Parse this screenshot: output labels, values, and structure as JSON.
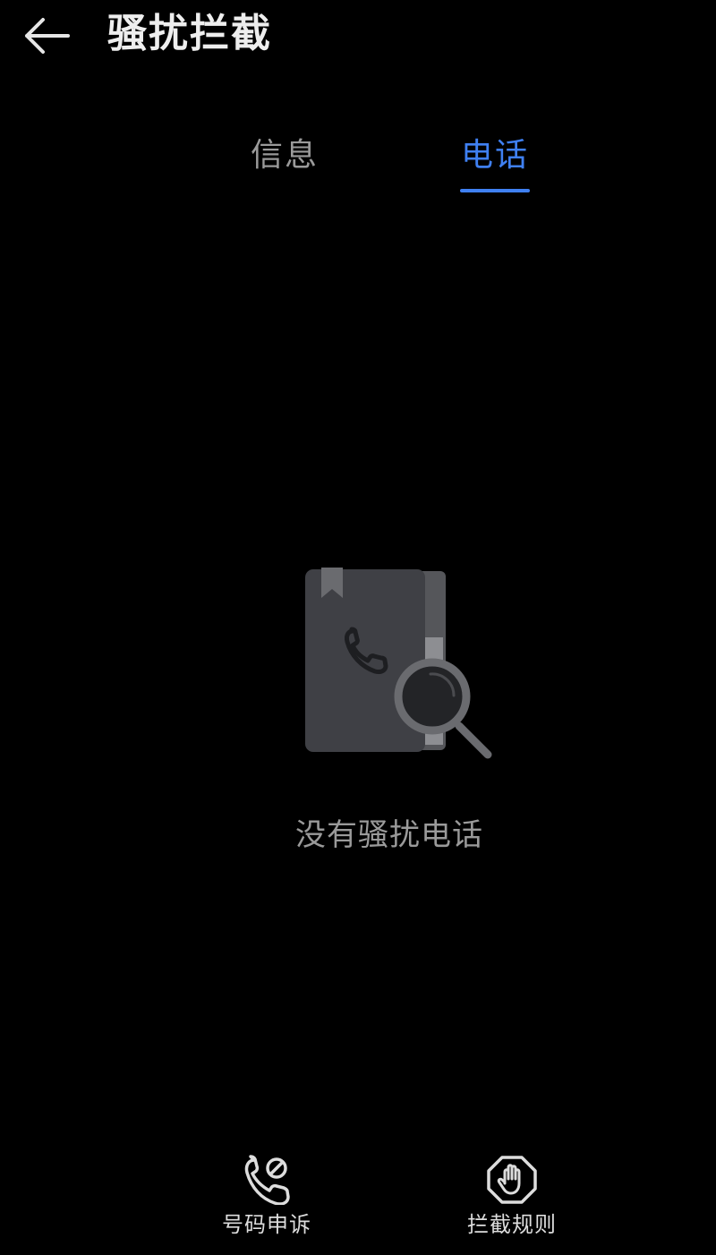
{
  "header": {
    "title": "骚扰拦截",
    "back_icon": "arrow-left-icon"
  },
  "tabs": [
    {
      "label": "信息",
      "active": false
    },
    {
      "label": "电话",
      "active": true
    }
  ],
  "colors": {
    "background": "#000000",
    "accent": "#3f80f2",
    "text_inactive": "#9a9a9a",
    "illustration": "#3f4045"
  },
  "empty_state": {
    "icon": "phonebook-search-icon",
    "text": "没有骚扰电话"
  },
  "bottom_actions": [
    {
      "label": "号码申诉",
      "icon": "phone-blocked-icon"
    },
    {
      "label": "拦截规则",
      "icon": "hand-stop-hexagon-icon"
    }
  ]
}
